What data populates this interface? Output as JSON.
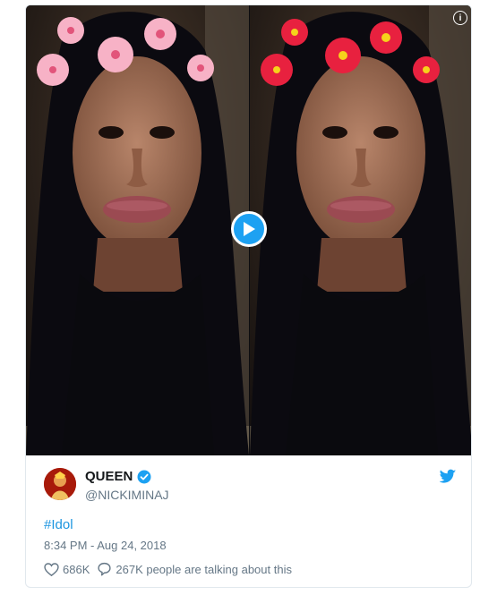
{
  "tweet": {
    "display_name": "QUEEN",
    "handle": "@NICKIMINAJ",
    "hashtag": "#Idol",
    "timestamp": "8:34 PM - Aug 24, 2018",
    "likes": "686K",
    "talking": "267K people are talking about this"
  },
  "media": {
    "info_label": "i",
    "left_flower_color": "#f7b2c6",
    "right_flower_color": "#e8213f"
  },
  "colors": {
    "twitter_blue": "#1da1f2",
    "link_blue": "#1b95e0",
    "muted_text": "#657786"
  },
  "icons": [
    "info-icon",
    "play-icon",
    "verified-badge-icon",
    "twitter-bird-icon",
    "heart-icon",
    "reply-bubble-icon"
  ]
}
